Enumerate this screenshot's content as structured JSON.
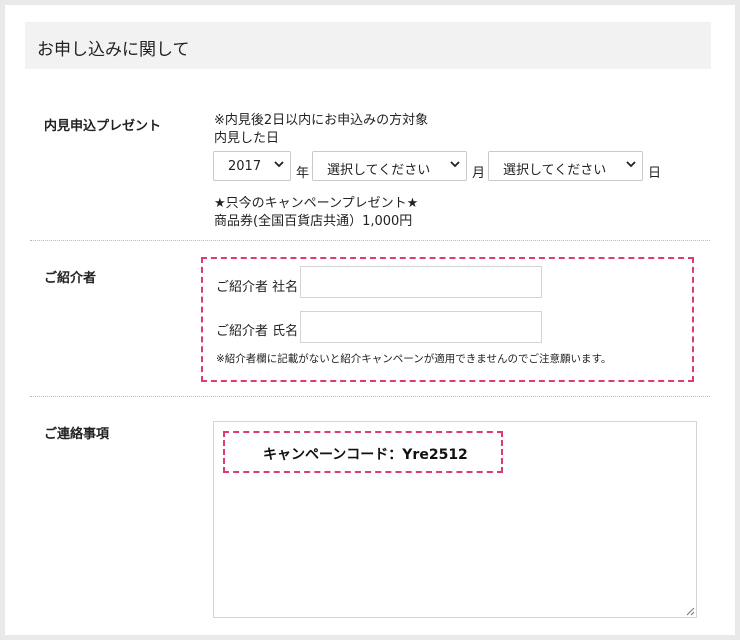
{
  "section": {
    "title": "お申し込みに関して"
  },
  "present": {
    "label": "内見申込プレゼント",
    "note": "※内見後2日以内にお申込みの方対象",
    "date_label": "内見した日",
    "year_select": {
      "value": "2017"
    },
    "year_unit": "年",
    "month_select": {
      "value": "選択してください"
    },
    "month_unit": "月",
    "day_select": {
      "value": "選択してください"
    },
    "day_unit": "日",
    "campaign_title": "★只今のキャンペーンプレゼント★",
    "campaign_detail": "商品券(全国百貨店共通）1,000円"
  },
  "referrer": {
    "label": "ご紹介者",
    "company_label": "ご紹介者 社名",
    "company_value": "",
    "name_label": "ご紹介者 氏名",
    "name_value": "",
    "warning": "※紹介者欄に記載がないと紹介キャンペーンが適用できませんのでご注意願います。"
  },
  "contact": {
    "label": "ご連絡事項",
    "value": "",
    "campaign_code": "キャンペーンコード：Yre2512"
  },
  "colors": {
    "accent": "#e03b6e",
    "header_bg": "#f2f2f2",
    "page_bg": "#e9e9e9"
  },
  "icons": {
    "select_chevron": "chevron-down-icon",
    "resize": "resize-grip-icon"
  }
}
